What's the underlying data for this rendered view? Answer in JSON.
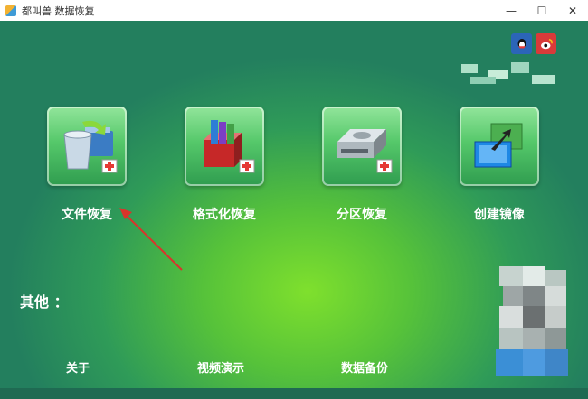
{
  "window": {
    "title": "都叫兽 数据恢复",
    "controls": {
      "minimize": "—",
      "maximize": "☐",
      "close": "✕"
    }
  },
  "social": [
    {
      "name": "qq-icon"
    },
    {
      "name": "weibo-icon"
    }
  ],
  "tiles": [
    {
      "label": "文件恢复",
      "icon": "file-recover-icon"
    },
    {
      "label": "格式化恢复",
      "icon": "format-recover-icon"
    },
    {
      "label": "分区恢复",
      "icon": "partition-recover-icon"
    },
    {
      "label": "创建镜像",
      "icon": "create-image-icon"
    }
  ],
  "other": {
    "title": "其他 ：",
    "links": [
      {
        "label": "关于"
      },
      {
        "label": "视频演示"
      },
      {
        "label": "数据备份"
      }
    ]
  },
  "colors": {
    "bg_center": "#7fe02d",
    "bg_edge": "#237f5e",
    "annotation_arrow": "#d9342b"
  }
}
